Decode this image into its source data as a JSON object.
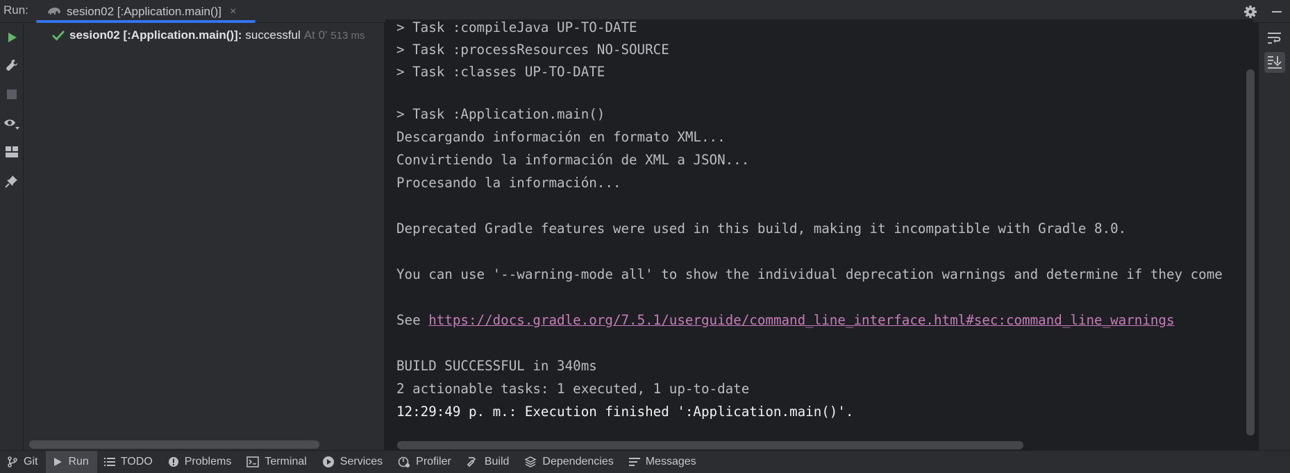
{
  "header": {
    "run_label": "Run:",
    "tab_title": "sesion02 [:Application.main()]",
    "tab_close": "×"
  },
  "tree": {
    "row_name": "sesion02 [:Application.main()]:",
    "row_status": "successful",
    "row_time": "At 0'",
    "row_duration": "513 ms"
  },
  "console": {
    "lines": [
      "> Task :compileJava UP-TO-DATE",
      "> Task :processResources NO-SOURCE",
      "> Task :classes UP-TO-DATE",
      "",
      "> Task :Application.main()",
      "Descargando información en formato XML...",
      "Convirtiendo la información de XML a JSON...",
      "Procesando la información...",
      "",
      "Deprecated Gradle features were used in this build, making it incompatible with Gradle 8.0.",
      "",
      "You can use '--warning-mode all' to show the individual deprecation warnings and determine if they come",
      "",
      "See ",
      "",
      "BUILD SUCCESSFUL in 340ms",
      "2 actionable tasks: 1 executed, 1 up-to-date",
      "12:29:49 p. m.: Execution finished ':Application.main()'."
    ],
    "link": "https://docs.gradle.org/7.5.1/userguide/command_line_interface.html#sec:command_line_warnings"
  },
  "bottom_bar": {
    "git": "Git",
    "run": "Run",
    "todo": "TODO",
    "problems": "Problems",
    "terminal": "Terminal",
    "services": "Services",
    "profiler": "Profiler",
    "build": "Build",
    "dependencies": "Dependencies",
    "messages": "Messages"
  },
  "colors": {
    "background": "#1e1f22",
    "panel": "#2b2d30",
    "accent": "#3574f0",
    "success": "#5fb865",
    "link": "#c77dbb"
  },
  "icons": {
    "tab": "gradle-elephant-icon",
    "tree_status": "check-icon",
    "left_toolbar": [
      "play-icon",
      "wrench-icon",
      "stop-icon",
      "eye-icon",
      "layout-icon",
      "pin-icon"
    ],
    "right_toolbar": [
      "soft-wrap-icon",
      "scroll-to-end-icon"
    ],
    "header_right": [
      "gear-icon",
      "minimize-icon"
    ]
  }
}
